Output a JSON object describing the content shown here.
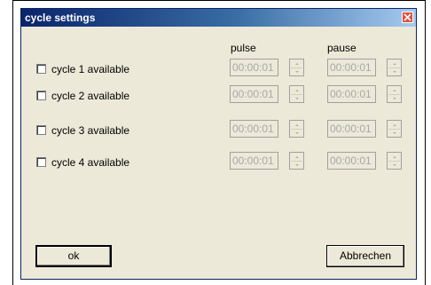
{
  "window": {
    "title": "cycle settings"
  },
  "columns": {
    "pulse_label": "pulse",
    "pause_label": "pause"
  },
  "cycles": [
    {
      "label": "cycle 1 available",
      "checked": false,
      "pulse": "00:00:01",
      "pause": "00:00:01"
    },
    {
      "label": "cycle 2 available",
      "checked": false,
      "pulse": "00:00:01",
      "pause": "00:00:01"
    },
    {
      "label": "cycle 3 available",
      "checked": false,
      "pulse": "00:00:01",
      "pause": "00:00:01"
    },
    {
      "label": "cycle 4 available",
      "checked": false,
      "pulse": "00:00:01",
      "pause": "00:00:01"
    }
  ],
  "buttons": {
    "ok_label": "ok",
    "cancel_label": "Abbrechen"
  },
  "icons": {
    "close": "close-icon",
    "spin_up": "spin-up-icon",
    "spin_down": "spin-down-icon"
  }
}
